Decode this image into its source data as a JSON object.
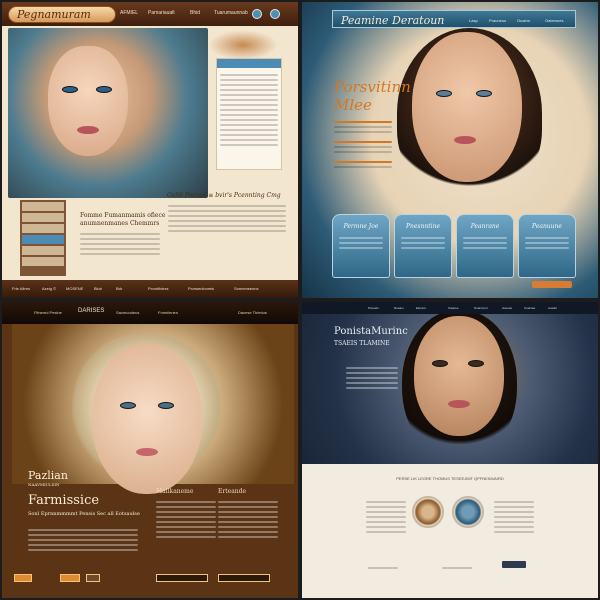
{
  "panels": {
    "p1": {
      "logo": "Pegnamuram",
      "menu": [
        "AFMIEL",
        "Pamariaualt",
        "Bhid",
        "Tuarumaunnab"
      ],
      "heading": "OsS6 Poezad ≡ bvir's Pcennting Cmg",
      "title_lines": [
        "Fomme Fumanmamis ofiece",
        "anumnenmanes Chemmrs"
      ],
      "footer": [
        "Frle Afinrs",
        "Azeig ©",
        "MOSENE",
        "Bluir",
        "Bdr",
        "Pcnnitivtrss",
        "Pcmsenlonmis",
        "Sonnenseons"
      ]
    },
    "p2": {
      "logo": "Peamine Deratoun",
      "menu": [
        "Lasp",
        "Prauneus",
        "Ouaem",
        "Oatemues"
      ],
      "title": [
        "Porsvitinn",
        "Mlee"
      ],
      "cards": [
        "Permne Joe",
        "Pnesnntine",
        "Peanrane",
        "Peanuune"
      ]
    },
    "p3": {
      "nav": [
        "Fltnemd Peslne",
        "DARISES",
        "Sacmoodeus",
        "Frnmilenen",
        "Dacese Thimtus"
      ],
      "title_small": [
        "Pazlian",
        "NAAVMIULSIN"
      ],
      "title_big": "Farmissice",
      "subtitle": "Sonl Eprnnmmmmt Pensis Sec all Eotsaulse",
      "columns": [
        "Mallkaneme",
        "Erteande"
      ]
    },
    "p4": {
      "nav": [
        "Pouseln",
        "Rueam",
        "Eloinun",
        "Clearee",
        "Nnamcunl",
        "Aceeas",
        "Coarsas",
        "Ausiloi"
      ],
      "title": [
        "PonistaMurinc",
        "TSAEIS TLAMINE"
      ],
      "heading": "PERSE LIK LEORE THOMUS  TESEEJIMT QPFNEINVAIRD"
    }
  },
  "colors": {
    "brown_nav": "#3e1f0e",
    "blue_accent": "#4c8cb4",
    "orange_accent": "#d07828",
    "navy": "#1a2537"
  }
}
